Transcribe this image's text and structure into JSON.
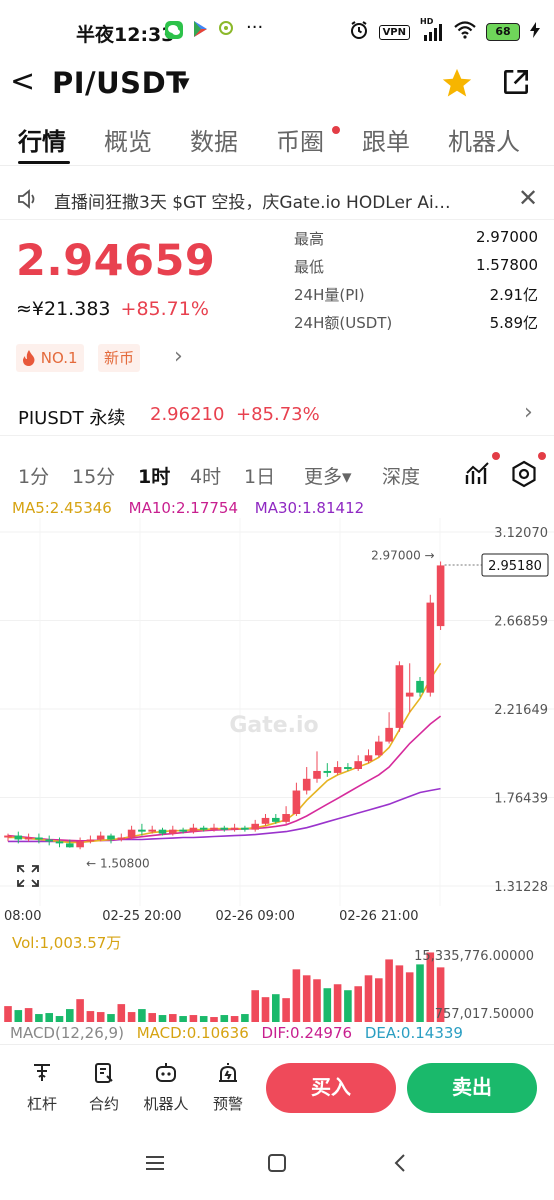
{
  "status_bar": {
    "time": "半夜12:33",
    "more": "···",
    "vpn": "VPN",
    "hd": "HD",
    "battery": "68"
  },
  "header": {
    "back": "<",
    "pair": "PI/USDT",
    "caret": "▼"
  },
  "tabs": [
    {
      "label": "行情",
      "active": true
    },
    {
      "label": "概览"
    },
    {
      "label": "数据"
    },
    {
      "label": "币圈"
    },
    {
      "label": "跟单"
    },
    {
      "label": "机器人"
    }
  ],
  "notice": {
    "text": "直播间狂撒3天 $GT 空投，庆Gate.io HODLer Ai…",
    "close": "✕"
  },
  "ticker": {
    "price": "2.94659",
    "cny": "≈¥21.383",
    "change": "+85.71%",
    "stats": [
      {
        "label": "最高",
        "value": "2.97000"
      },
      {
        "label": "最低",
        "value": "1.57800"
      },
      {
        "label": "24H量(PI)",
        "value": "2.91亿"
      },
      {
        "label": "24H额(USDT)",
        "value": "5.89亿"
      }
    ],
    "badge_rank": "NO.1",
    "badge_new": "新币",
    "chevron": "›"
  },
  "perpetual": {
    "name": "PIUSDT 永续",
    "price": "2.96210",
    "change": "+85.73%",
    "chevron": "›"
  },
  "intervals": {
    "items": [
      "1分",
      "15分",
      "1时",
      "4时",
      "1日"
    ],
    "active": "1时",
    "more": "更多▾",
    "depth": "深度"
  },
  "ma": {
    "ma5": "MA5:2.45346",
    "ma10": "MA10:2.17754",
    "ma30": "MA30:1.81412"
  },
  "chart_data": {
    "type": "candlestick",
    "watermark": "Gate.io",
    "y_ticks": [
      "3.12070",
      "2.66859",
      "2.21649",
      "1.76439",
      "1.31228"
    ],
    "y_tick_values": [
      3.1207,
      2.66859,
      2.21649,
      1.76439,
      1.31228
    ],
    "ylim": [
      1.31228,
      3.1207
    ],
    "x_ticks": [
      "08:00",
      "02-25 20:00",
      "02-26 09:00",
      "02-26 21:00"
    ],
    "x_tick_index": [
      0,
      13,
      24,
      36
    ],
    "high_label": "2.97000 →",
    "low_label": "← 1.50800",
    "last_price_label": "2.95180",
    "last_price": 2.9518,
    "candles": [
      [
        1.56,
        1.57,
        1.58,
        1.54
      ],
      [
        1.57,
        1.55,
        1.59,
        1.53
      ],
      [
        1.55,
        1.56,
        1.58,
        1.54
      ],
      [
        1.56,
        1.55,
        1.58,
        1.53
      ],
      [
        1.55,
        1.54,
        1.57,
        1.52
      ],
      [
        1.54,
        1.53,
        1.56,
        1.51
      ],
      [
        1.53,
        1.51,
        1.55,
        1.508
      ],
      [
        1.51,
        1.54,
        1.56,
        1.5
      ],
      [
        1.54,
        1.55,
        1.57,
        1.53
      ],
      [
        1.55,
        1.57,
        1.59,
        1.54
      ],
      [
        1.57,
        1.55,
        1.58,
        1.53
      ],
      [
        1.55,
        1.56,
        1.58,
        1.54
      ],
      [
        1.56,
        1.6,
        1.62,
        1.55
      ],
      [
        1.6,
        1.59,
        1.63,
        1.57
      ],
      [
        1.59,
        1.6,
        1.62,
        1.58
      ],
      [
        1.6,
        1.58,
        1.61,
        1.57
      ],
      [
        1.58,
        1.6,
        1.62,
        1.57
      ],
      [
        1.6,
        1.59,
        1.61,
        1.58
      ],
      [
        1.59,
        1.61,
        1.63,
        1.58
      ],
      [
        1.61,
        1.6,
        1.62,
        1.59
      ],
      [
        1.6,
        1.61,
        1.63,
        1.59
      ],
      [
        1.61,
        1.6,
        1.62,
        1.59
      ],
      [
        1.6,
        1.61,
        1.63,
        1.59
      ],
      [
        1.61,
        1.6,
        1.62,
        1.59
      ],
      [
        1.6,
        1.63,
        1.65,
        1.59
      ],
      [
        1.63,
        1.66,
        1.68,
        1.62
      ],
      [
        1.66,
        1.64,
        1.68,
        1.63
      ],
      [
        1.64,
        1.68,
        1.72,
        1.63
      ],
      [
        1.68,
        1.8,
        1.84,
        1.67
      ],
      [
        1.8,
        1.86,
        1.92,
        1.78
      ],
      [
        1.86,
        1.9,
        2.0,
        1.84
      ],
      [
        1.9,
        1.89,
        1.94,
        1.87
      ],
      [
        1.89,
        1.92,
        1.95,
        1.88
      ],
      [
        1.92,
        1.91,
        1.94,
        1.9
      ],
      [
        1.91,
        1.95,
        1.98,
        1.9
      ],
      [
        1.95,
        1.98,
        2.01,
        1.94
      ],
      [
        1.98,
        2.05,
        2.08,
        1.97
      ],
      [
        2.05,
        2.12,
        2.2,
        2.04
      ],
      [
        2.12,
        2.44,
        2.46,
        2.1
      ],
      [
        2.28,
        2.3,
        2.45,
        2.2
      ],
      [
        2.36,
        2.3,
        2.38,
        2.28
      ],
      [
        2.3,
        2.76,
        2.8,
        2.28
      ],
      [
        2.64,
        2.95,
        2.97,
        2.62
      ]
    ],
    "ma5_values": [
      1.56,
      1.56,
      1.555,
      1.55,
      1.545,
      1.54,
      1.535,
      1.535,
      1.54,
      1.545,
      1.55,
      1.555,
      1.565,
      1.575,
      1.585,
      1.59,
      1.595,
      1.595,
      1.6,
      1.6,
      1.605,
      1.605,
      1.605,
      1.605,
      1.61,
      1.62,
      1.635,
      1.65,
      1.69,
      1.75,
      1.8,
      1.85,
      1.88,
      1.9,
      1.92,
      1.94,
      1.97,
      2.02,
      2.11,
      2.2,
      2.27,
      2.37,
      2.45
    ],
    "ma10_values": [
      1.57,
      1.565,
      1.56,
      1.555,
      1.55,
      1.548,
      1.545,
      1.543,
      1.543,
      1.545,
      1.548,
      1.552,
      1.558,
      1.564,
      1.57,
      1.576,
      1.58,
      1.585,
      1.59,
      1.595,
      1.598,
      1.6,
      1.602,
      1.604,
      1.606,
      1.61,
      1.617,
      1.625,
      1.645,
      1.67,
      1.7,
      1.73,
      1.76,
      1.79,
      1.82,
      1.85,
      1.88,
      1.92,
      1.98,
      2.04,
      2.09,
      2.14,
      2.18
    ],
    "ma30_values": [
      1.54,
      1.54,
      1.54,
      1.54,
      1.54,
      1.54,
      1.54,
      1.54,
      1.545,
      1.545,
      1.545,
      1.55,
      1.55,
      1.55,
      1.553,
      1.555,
      1.557,
      1.56,
      1.56,
      1.562,
      1.565,
      1.567,
      1.57,
      1.572,
      1.575,
      1.58,
      1.585,
      1.59,
      1.6,
      1.61,
      1.625,
      1.64,
      1.655,
      1.67,
      1.685,
      1.7,
      1.715,
      1.73,
      1.75,
      1.77,
      1.79,
      1.8,
      1.81
    ]
  },
  "volume": {
    "label": "Vol:1,003.57万",
    "y_ticks": [
      "15,335,776.00000",
      "757,017.50000"
    ],
    "bars": [
      3.2,
      2.4,
      2.8,
      1.6,
      1.8,
      1.2,
      2.6,
      4.6,
      2.2,
      2.0,
      1.6,
      3.6,
      2.0,
      2.6,
      1.8,
      1.4,
      1.6,
      1.2,
      1.4,
      1.2,
      1.0,
      1.4,
      1.2,
      1.6,
      6.4,
      5.0,
      5.6,
      4.8,
      10.6,
      9.4,
      8.6,
      6.8,
      7.6,
      6.4,
      7.2,
      9.4,
      8.8,
      12.6,
      11.4,
      10.0,
      11.6,
      14.0,
      11.0
    ],
    "vol_max": 15.3
  },
  "macd": {
    "title": "MACD(12,26,9)",
    "macd": "MACD:0.10636",
    "dif": "DIF:0.24976",
    "dea": "DEA:0.14339"
  },
  "bottom_bar": {
    "items": [
      {
        "label": "杠杆",
        "icon": "leverage-icon"
      },
      {
        "label": "合约",
        "icon": "contract-icon"
      },
      {
        "label": "机器人",
        "icon": "robot-icon"
      },
      {
        "label": "预警",
        "icon": "alert-icon"
      }
    ],
    "buy": "买入",
    "sell": "卖出"
  },
  "colors": {
    "up": "#ef4a5a",
    "down": "#1ab96b",
    "ma5": "#e6b422",
    "ma10": "#d62b9c",
    "ma30": "#9a33cc"
  }
}
